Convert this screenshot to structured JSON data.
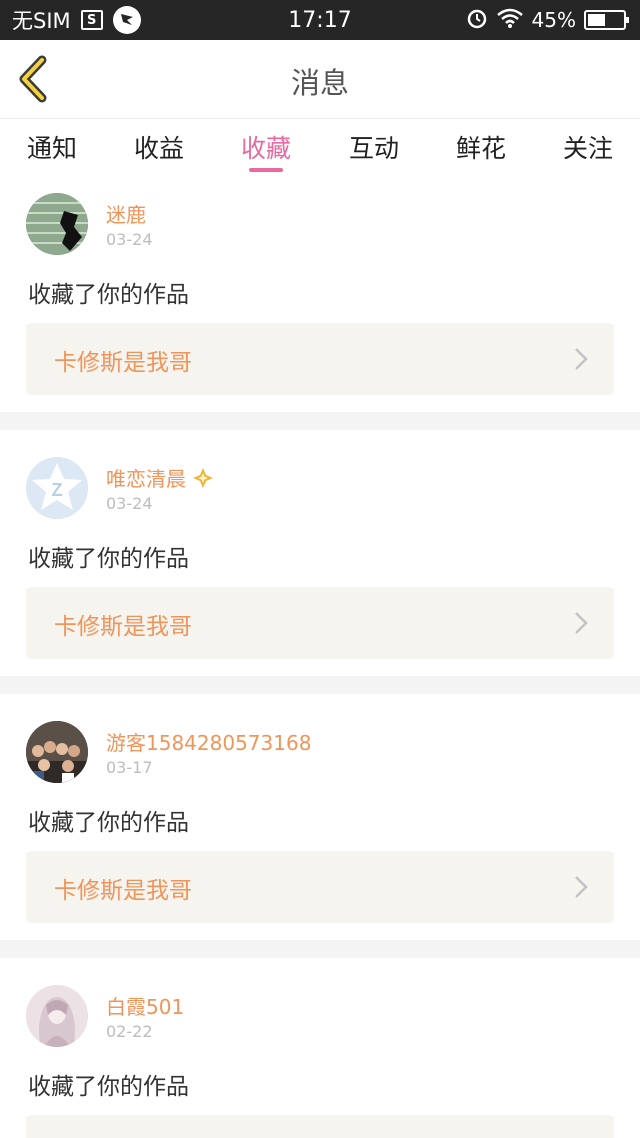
{
  "status_bar": {
    "carrier": "无SIM",
    "carrier_icon": "S",
    "time": "17:17",
    "battery": "45%"
  },
  "nav": {
    "title": "消息"
  },
  "tabs": [
    {
      "label": "通知"
    },
    {
      "label": "收益"
    },
    {
      "label": "收藏",
      "active": true
    },
    {
      "label": "互动"
    },
    {
      "label": "鲜花"
    },
    {
      "label": "关注"
    }
  ],
  "colors": {
    "accent": "#e86a9f",
    "username": "#f0955a"
  },
  "messages": [
    {
      "user": "迷鹿",
      "date": "03-24",
      "action": "收藏了你的作品",
      "work": "卡修斯是我哥"
    },
    {
      "user": "唯恋清晨",
      "date": "03-24",
      "action": "收藏了你的作品",
      "work": "卡修斯是我哥"
    },
    {
      "user": "游客1584280573168",
      "date": "03-17",
      "action": "收藏了你的作品",
      "work": "卡修斯是我哥"
    },
    {
      "user": "白霞501",
      "date": "02-22",
      "action": "收藏了你的作品",
      "work": ""
    }
  ]
}
